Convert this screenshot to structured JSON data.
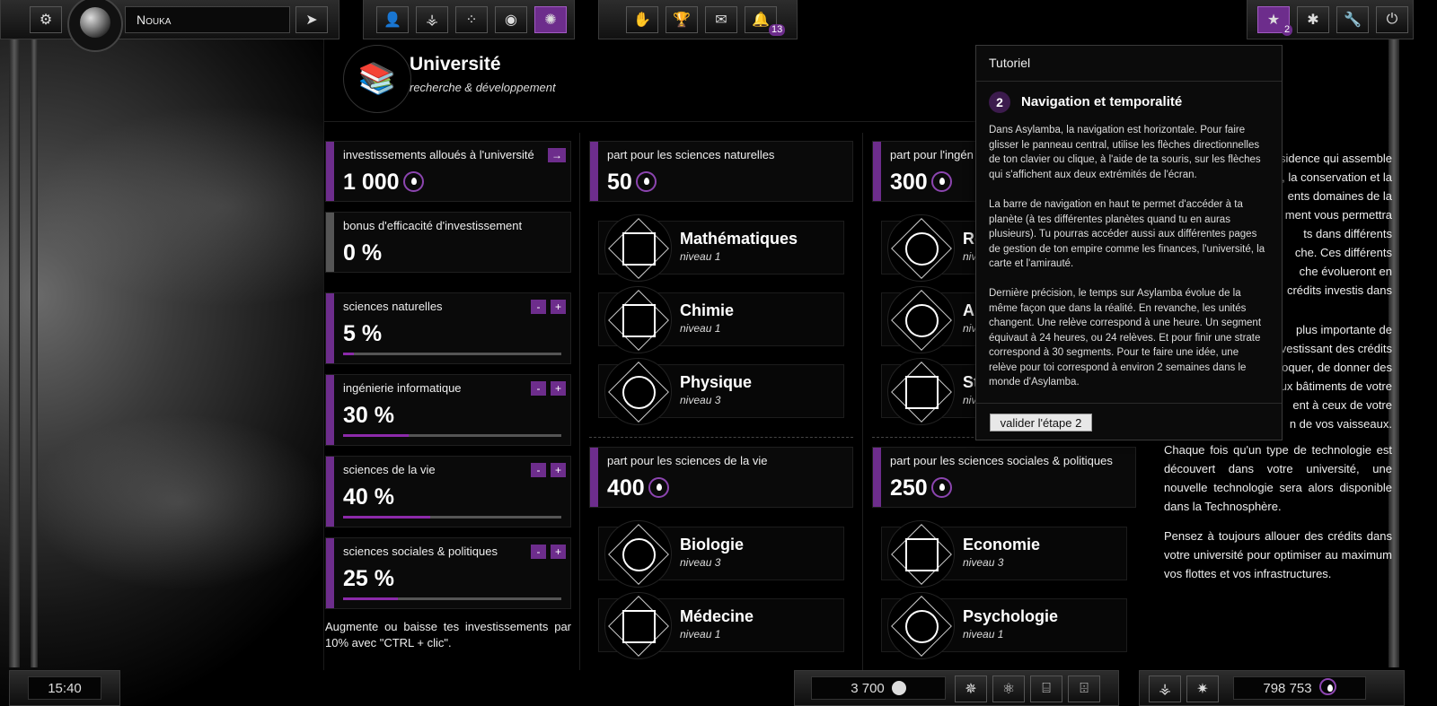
{
  "topbar": {
    "planet_name": "Nouka",
    "notifications_count": "13",
    "tutorial_count": "2"
  },
  "header": {
    "title": "Université",
    "subtitle": "recherche & développement"
  },
  "investment": {
    "label": "investissements alloués à l'université",
    "value": "1 000",
    "bonus_label": "bonus d'efficacité d'investissement",
    "bonus_value": "0 %",
    "sliders": [
      {
        "label": "sciences naturelles",
        "value": "5 %",
        "fraction": 0.05
      },
      {
        "label": "ingénierie informatique",
        "value": "30 %",
        "fraction": 0.3
      },
      {
        "label": "sciences de la vie",
        "value": "40 %",
        "fraction": 0.4
      },
      {
        "label": "sciences sociales & politiques",
        "value": "25 %",
        "fraction": 0.25
      }
    ],
    "minus": "-",
    "plus": "+",
    "hint": "Augmente ou baisse tes investissements par 10% avec \"CTRL + clic\"."
  },
  "natural": {
    "label": "part pour les sciences naturelles",
    "value": "50",
    "techs": [
      {
        "name": "Mathématiques",
        "level": "niveau 1"
      },
      {
        "name": "Chimie",
        "level": "niveau 1"
      },
      {
        "name": "Physique",
        "level": "niveau 3"
      }
    ]
  },
  "life": {
    "label": "part pour les sciences de la vie",
    "value": "400",
    "techs": [
      {
        "name": "Biologie",
        "level": "niveau 3"
      },
      {
        "name": "Médecine",
        "level": "niveau 1"
      }
    ]
  },
  "engineering": {
    "label": "part pour l'ingén",
    "value": "300",
    "techs": [
      {
        "name": "Ro",
        "level": "niv"
      },
      {
        "name": "Al",
        "level": "niv"
      },
      {
        "name": "St",
        "level": "niv"
      }
    ]
  },
  "social": {
    "label": "part pour les sciences sociales & politiques",
    "value": "250",
    "techs": [
      {
        "name": "Economie",
        "level": "niveau 3"
      },
      {
        "name": "Psychologie",
        "level": "niveau 1"
      }
    ]
  },
  "info_text": {
    "p1": [
      "sidence qui assemble",
      "e, la conservation et la",
      "ents domaines de la",
      "ment vous permettra",
      "ts dans différents",
      "che. Ces différents",
      "che évolueront en",
      "crédits investis dans"
    ],
    "p2": [
      "plus importante de",
      "vestissant des crédits",
      "oquer, de donner des",
      "ux bâtiments de votre",
      "ent à ceux de votre",
      "n de vos vaisseaux."
    ],
    "p3": "Chaque fois qu'un type de technologie est découvert dans votre université, une nouvelle technologie sera alors disponible dans la Technosphère.",
    "p4": "Pensez à toujours allouer des crédits dans votre université pour optimiser au maximum vos flottes et vos infrastructures."
  },
  "tutorial": {
    "title": "Tutoriel",
    "step_number": "2",
    "step_title": "Navigation et temporalité",
    "p1": "Dans Asylamba, la navigation est horizontale. Pour faire glisser le panneau central, utilise les flèches directionnelles de ton clavier ou clique, à l'aide de ta souris, sur les flèches qui s'affichent aux deux extrémités de l'écran.",
    "p2": "La barre de navigation en haut te permet d'accéder à ta planète (à tes différentes planètes quand tu en auras plusieurs). Tu pourras accéder aussi aux différentes pages de gestion de ton empire comme les finances, l'université, la carte et l'amirauté.",
    "p3": "Dernière précision, le temps sur Asylamba évolue de la même façon que dans la réalité. En revanche, les unités changent. Une relève correspond à une heure. Un segment équivaut à 24 heures, ou 24 relèves. Et pour finir une strate correspond à 30 segments. Pour te faire une idée, une relève pour toi correspond à environ 2 semaines dans le monde d'Asylamba.",
    "button": "valider l'étape 2"
  },
  "bottombar": {
    "time": "15:40",
    "resources": "3 700",
    "credits": "798 753"
  },
  "colors": {
    "accent": "#6d2d8c",
    "bar_track": "#555555"
  }
}
